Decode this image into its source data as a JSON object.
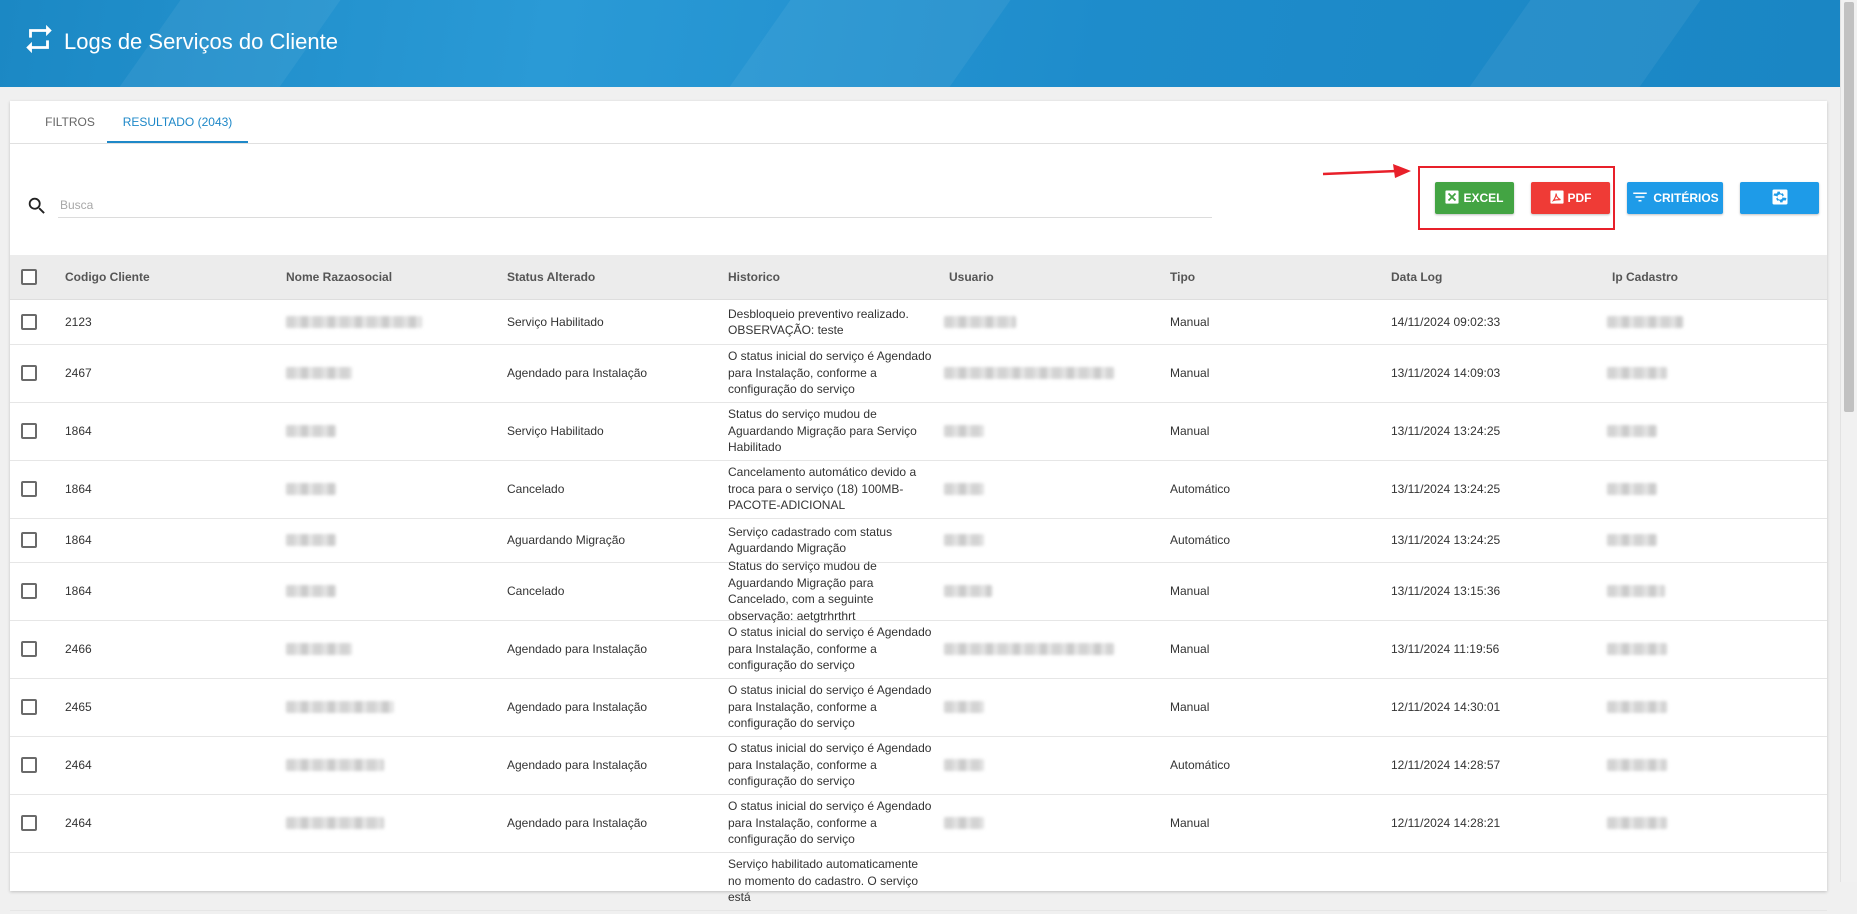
{
  "header": {
    "title": "Logs de Serviços do Cliente"
  },
  "tabs": [
    {
      "label": "FILTROS",
      "active": false
    },
    {
      "label": "RESULTADO (2043)",
      "active": true
    }
  ],
  "search": {
    "placeholder": "Busca",
    "value": ""
  },
  "toolbar": {
    "excel_label": "EXCEL",
    "pdf_label": "PDF",
    "criterios_label": "CRITÉRIOS",
    "excel_color": "#43a443",
    "pdf_color": "#ef3b36",
    "primary_color": "#1e9be8",
    "highlight_color": "#e8202a"
  },
  "table": {
    "columns": [
      "Codigo Cliente",
      "Nome Razaosocial",
      "Status Alterado",
      "Historico",
      "Usuario",
      "Tipo",
      "Data Log",
      "Ip Cadastro"
    ],
    "rows": [
      {
        "codigo": "2123",
        "status": "Serviço Habilitado",
        "historico": "Desbloqueio preventivo realizado. OBSERVAÇÃO: teste",
        "tipo": "Manual",
        "data": "14/11/2024 09:02:33"
      },
      {
        "codigo": "2467",
        "status": "Agendado para Instalação",
        "historico": "O status inicial do serviço é Agendado para Instalação, conforme a configuração do serviço",
        "tipo": "Manual",
        "data": "13/11/2024 14:09:03"
      },
      {
        "codigo": "1864",
        "status": "Serviço Habilitado",
        "historico": "Status do serviço mudou de Aguardando Migração para Serviço Habilitado",
        "tipo": "Manual",
        "data": "13/11/2024 13:24:25"
      },
      {
        "codigo": "1864",
        "status": "Cancelado",
        "historico": "Cancelamento automático devido a troca para o serviço (18) 100MB-PACOTE-ADICIONAL",
        "tipo": "Automático",
        "data": "13/11/2024 13:24:25"
      },
      {
        "codigo": "1864",
        "status": "Aguardando Migração",
        "historico": "Serviço cadastrado com status Aguardando Migração",
        "tipo": "Automático",
        "data": "13/11/2024 13:24:25"
      },
      {
        "codigo": "1864",
        "status": "Cancelado",
        "historico": "Status do serviço mudou de Aguardando Migração para Cancelado, com a seguinte observação: aetgtrhrthrt",
        "tipo": "Manual",
        "data": "13/11/2024 13:15:36"
      },
      {
        "codigo": "2466",
        "status": "Agendado para Instalação",
        "historico": "O status inicial do serviço é Agendado para Instalação, conforme a configuração do serviço",
        "tipo": "Manual",
        "data": "13/11/2024 11:19:56"
      },
      {
        "codigo": "2465",
        "status": "Agendado para Instalação",
        "historico": "O status inicial do serviço é Agendado para Instalação, conforme a configuração do serviço",
        "tipo": "Manual",
        "data": "12/11/2024 14:30:01"
      },
      {
        "codigo": "2464",
        "status": "Agendado para Instalação",
        "historico": "O status inicial do serviço é Agendado para Instalação, conforme a configuração do serviço",
        "tipo": "Automático",
        "data": "12/11/2024 14:28:57"
      },
      {
        "codigo": "2464",
        "status": "Agendado para Instalação",
        "historico": "O status inicial do serviço é Agendado para Instalação, conforme a configuração do serviço",
        "tipo": "Manual",
        "data": "12/11/2024 14:28:21"
      },
      {
        "codigo": "",
        "status": "",
        "historico": "Serviço habilitado automaticamente no momento do cadastro. O serviço está",
        "tipo": "",
        "data": ""
      }
    ]
  }
}
